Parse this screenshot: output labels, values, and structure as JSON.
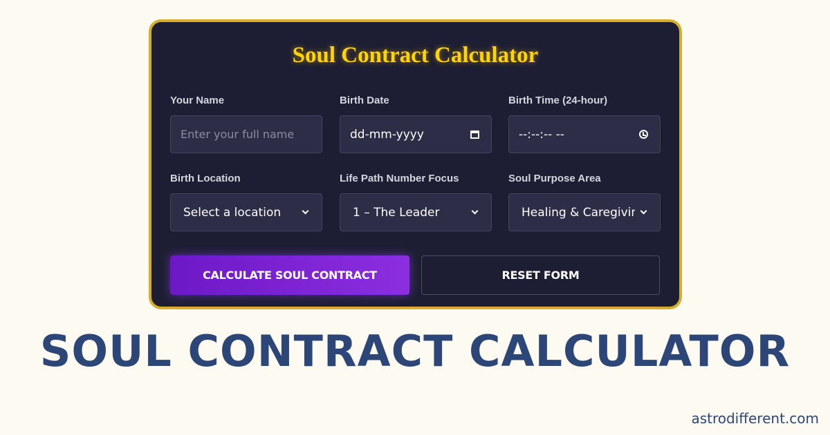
{
  "calculator": {
    "title": "Soul Contract Calculator",
    "fields": {
      "name": {
        "label": "Your Name",
        "placeholder": "Enter your full name"
      },
      "birth_date": {
        "label": "Birth Date",
        "value": "dd-mm-yyyy",
        "icon": "calendar-icon"
      },
      "birth_time": {
        "label": "Birth Time (24-hour)",
        "value": "--:--:-- --",
        "icon": "clock-icon"
      },
      "birth_location": {
        "label": "Birth Location",
        "value": "Select a location",
        "icon": "chevron-down-icon"
      },
      "life_path": {
        "label": "Life Path Number Focus",
        "value": "1 – The Leader",
        "icon": "chevron-down-icon"
      },
      "soul_purpose": {
        "label": "Soul Purpose Area",
        "value": "Healing & Caregiving",
        "icon": "chevron-down-icon"
      }
    },
    "buttons": {
      "calculate": "CALCULATE SOUL CONTRACT",
      "reset": "RESET FORM"
    }
  },
  "headline": "SOUL CONTRACT CALCULATOR",
  "site": "astrodifferent.com",
  "colors": {
    "background": "#fdfaf1",
    "card": "#1d1e33",
    "card_border": "#d9ad2c",
    "title": "#ffd400",
    "primary_button": "#7a22d4",
    "headline": "#2b4677"
  }
}
